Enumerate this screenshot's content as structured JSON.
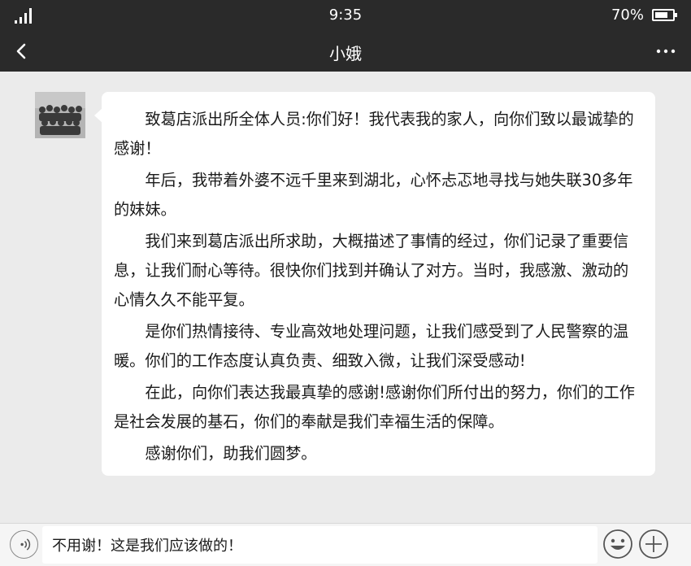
{
  "status_bar": {
    "time": "9:35",
    "battery_text": "70%",
    "battery_level": 0.7,
    "signal_icon": "signal-icon",
    "battery_icon": "battery-icon"
  },
  "header": {
    "title": "小娥",
    "back_icon": "chevron-left-icon",
    "more_icon": "more-icon"
  },
  "message": {
    "paragraphs": [
      "致葛店派出所全体人员:你们好！我代表我的家人，向你们致以最诚挚的感谢！",
      "年后，我带着外婆不远千里来到湖北，心怀忐忑地寻找与她失联30多年的妹妹。",
      "我们来到葛店派出所求助，大概描述了事情的经过，你们记录了重要信息，让我们耐心等待。很快你们找到并确认了对方。当时，我感激、激动的心情久久不能平复。",
      "是你们热情接待、专业高效地处理问题，让我们感受到了人民警察的温暖。你们的工作态度认真负责、细致入微，让我们深受感动!",
      "在此，向你们表达我最真挚的感谢!感谢你们所付出的努力，你们的工作是社会发展的基石，你们的奉献是我们幸福生活的保障。",
      "感谢你们，助我们圆梦。"
    ]
  },
  "input_bar": {
    "value": "不用谢！这是我们应该做的！",
    "voice_icon": "voice-icon",
    "emoji_icon": "emoji-icon",
    "add_icon": "plus-icon"
  },
  "colors": {
    "header_bg": "#2a2a2a",
    "chat_bg": "#ebebeb",
    "bubble_bg": "#ffffff"
  }
}
